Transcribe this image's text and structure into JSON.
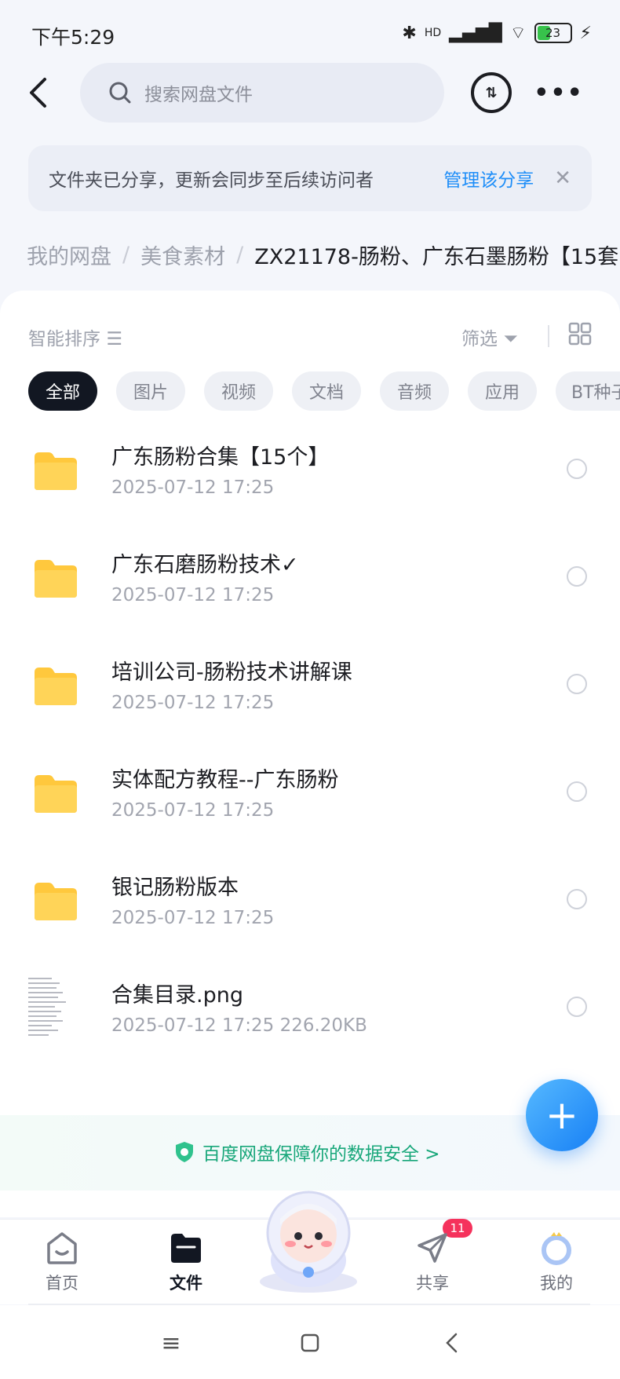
{
  "status_bar": {
    "time": "下午5:29",
    "battery": "23",
    "network": "HD"
  },
  "header": {
    "search_placeholder": "搜索网盘文件"
  },
  "banner": {
    "text": "文件夹已分享，更新会同步至后续访问者",
    "link": "管理该分享",
    "close": "✕"
  },
  "breadcrumb": {
    "items": [
      "我的网盘",
      "美食素材",
      "ZX21178-肠粉、广东石墨肠粉【15套"
    ]
  },
  "toolbar": {
    "sort": "智能排序",
    "filter": "筛选"
  },
  "chips": [
    "全部",
    "图片",
    "视频",
    "文档",
    "音频",
    "应用",
    "BT种子"
  ],
  "files": [
    {
      "name": "广东肠粉合集【15个】",
      "meta": "2025-07-12  17:25",
      "type": "folder"
    },
    {
      "name": "广东石磨肠粉技术✓",
      "meta": "2025-07-12  17:25",
      "type": "folder"
    },
    {
      "name": "培训公司-肠粉技术讲解课",
      "meta": "2025-07-12  17:25",
      "type": "folder"
    },
    {
      "name": "实体配方教程--广东肠粉",
      "meta": "2025-07-12  17:25",
      "type": "folder"
    },
    {
      "name": "银记肠粉版本",
      "meta": "2025-07-12  17:25",
      "type": "folder"
    },
    {
      "name": "合集目录.png",
      "meta": "2025-07-12  17:25  226.20KB",
      "type": "image"
    }
  ],
  "safety": {
    "text": "百度网盘保障你的数据安全 >"
  },
  "fab": {
    "label": "+"
  },
  "tabs": [
    {
      "label": "首页",
      "icon": "home-icon"
    },
    {
      "label": "文件",
      "icon": "folder-icon"
    },
    {
      "label": "共享",
      "icon": "send-icon",
      "badge": "11"
    },
    {
      "label": "我的",
      "icon": "profile-icon"
    }
  ],
  "colors": {
    "accent": "#1f8ef8",
    "folder": "#ffc83d",
    "safety": "#18a77a",
    "badge": "#f5325c"
  }
}
